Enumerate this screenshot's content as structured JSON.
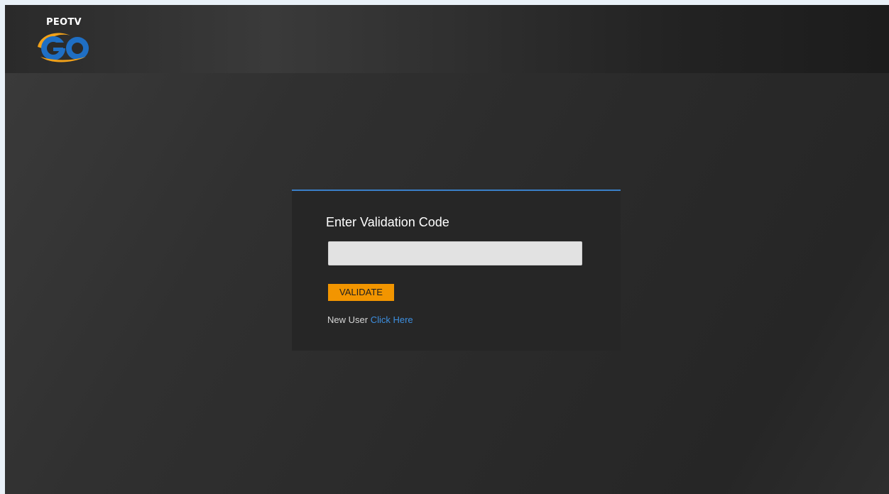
{
  "header": {
    "logo_text": "PEOTV",
    "logo_mark": "GO"
  },
  "validation": {
    "title": "Enter Validation Code",
    "input_value": "",
    "input_placeholder": "",
    "validate_label": "VALIDATE",
    "new_user_text": "New User",
    "click_here_label": "Click Here"
  },
  "colors": {
    "accent_blue": "#3a7fc7",
    "button_orange": "#f29500",
    "link_blue": "#3d8fe0"
  }
}
